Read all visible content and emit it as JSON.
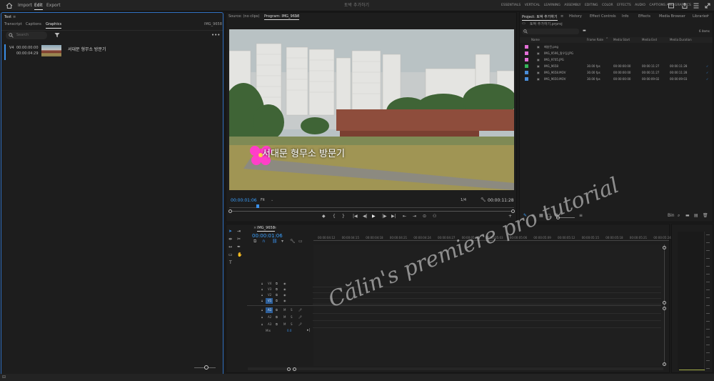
{
  "topbar": {
    "nav": [
      "Import",
      "Edit",
      "Export"
    ],
    "doc_title": "토박 추가하기",
    "workspaces": [
      "ESSENTIALS",
      "VERTICAL",
      "LEARNING",
      "ASSEMBLY",
      "EDITING",
      "COLOR",
      "EFFECTS",
      "AUDIO",
      "CAPTIONS AND GRAPHICS"
    ]
  },
  "text_panel": {
    "title": "Text",
    "tabs": [
      "Transcript",
      "Captions",
      "Graphics"
    ],
    "sequence_name": "IMG_9658",
    "search_placeholder": "Search",
    "item": {
      "track": "V4",
      "in": "00:00:00:00",
      "out": "00:00:04:29",
      "label": "서대문 형무소 방문기"
    }
  },
  "program": {
    "tabs": [
      "Source: (no clips)",
      "Program: IMG_9658"
    ],
    "overlay_text": "서대문 형무소 방문기",
    "timecode": "00:00:01:06",
    "fit": "Fit",
    "quality": "1/4",
    "duration": "00:00:11:28",
    "transport": [
      "◆",
      "{",
      "}",
      "|◀",
      "◀|",
      "◀",
      "▶",
      "|▶",
      "▶|",
      "⇤",
      "⇥",
      "⊙",
      "⚇"
    ]
  },
  "project": {
    "tabs": [
      "Project: 토박 추가하기",
      "History",
      "Effect Controls",
      "Info",
      "Effects",
      "Media Browser",
      "Libraries"
    ],
    "path": "토박 추가하기.prproj",
    "item_count": "6 items",
    "columns": [
      "Name",
      "Frame Rate",
      "Media Start",
      "Media End",
      "Media Duration"
    ],
    "rows": [
      {
        "color": "#e36fd6",
        "name": "배송된.png",
        "fps": "",
        "start": "",
        "end": "",
        "dur": ""
      },
      {
        "color": "#e36fd6",
        "name": "IMG_9596_필우집.JPG",
        "fps": "",
        "start": "",
        "end": "",
        "dur": ""
      },
      {
        "color": "#e36fd6",
        "name": "IMG_9705.JPG",
        "fps": "",
        "start": "",
        "end": "",
        "dur": ""
      },
      {
        "color": "#36b55a",
        "name": "IMG_9658",
        "fps": "30.00 fps",
        "start": "00:00:00:00",
        "end": "00:00:11:27",
        "dur": "00:00:11:28"
      },
      {
        "color": "#4a8dd8",
        "name": "IMG_9658.MOV",
        "fps": "30.00 fps",
        "start": "00:00:00:00",
        "end": "00:00:11:27",
        "dur": "00:00:11:28"
      },
      {
        "color": "#4a8dd8",
        "name": "IMG_9650.MOV",
        "fps": "30.00 fps",
        "start": "00:00:00:00",
        "end": "00:00:09:02",
        "dur": "00:00:09:03"
      }
    ]
  },
  "timeline": {
    "tab": "IMG_9658",
    "timecode": "00:00:01:06",
    "ruler": [
      "00:00:04:12",
      "00:00:04:15",
      "00:00:04:18",
      "00:00:04:21",
      "00:00:04:24",
      "00:00:04:27",
      "00:00:05:00",
      "00:00:05:03",
      "00:00:05:06",
      "00:00:05:09",
      "00:00:05:12",
      "00:00:05:15",
      "00:00:05:18",
      "00:00:05:21",
      "00:00:05:24"
    ],
    "tracks": [
      {
        "name": "V4",
        "kind": "video"
      },
      {
        "name": "V3",
        "kind": "video"
      },
      {
        "name": "V2",
        "kind": "video"
      },
      {
        "name": "V1",
        "kind": "video",
        "target": "V1"
      },
      {
        "name": "A1",
        "kind": "audio",
        "target": "A1"
      },
      {
        "name": "A2",
        "kind": "audio"
      },
      {
        "name": "A3",
        "kind": "audio"
      }
    ],
    "mix_label": "Mix",
    "mix_value": "0.0",
    "watermark": "Călin's premiere pro tutorial"
  }
}
